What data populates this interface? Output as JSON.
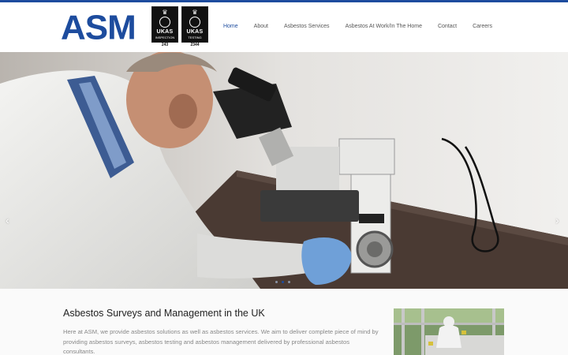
{
  "brand": {
    "logo_text": "ASM",
    "accent_color": "#1d4c9e",
    "badges": [
      {
        "name": "UKAS",
        "kind": "INSPECTION",
        "number": "243"
      },
      {
        "name": "UKAS",
        "kind": "TESTING",
        "number": "2344"
      }
    ]
  },
  "nav": {
    "items": [
      {
        "label": "Home"
      },
      {
        "label": "About"
      },
      {
        "label": "Asbestos Services"
      },
      {
        "label": "Asbestos At Work/In The Home"
      },
      {
        "label": "Contact"
      },
      {
        "label": "Careers"
      }
    ]
  },
  "hero": {
    "prev_icon": "chevron-left-icon",
    "next_icon": "chevron-right-icon",
    "prev_glyph": "‹",
    "next_glyph": "›",
    "slide_count": 3,
    "active_slide": 2
  },
  "content": {
    "heading": "Asbestos Surveys and Management in the UK",
    "body": "Here at ASM, we provide asbestos solutions as well as asbestos services. We aim to deliver complete piece of mind by providing asbestos surveys, asbestos testing and asbestos management delivered by professional asbestos consultants."
  }
}
